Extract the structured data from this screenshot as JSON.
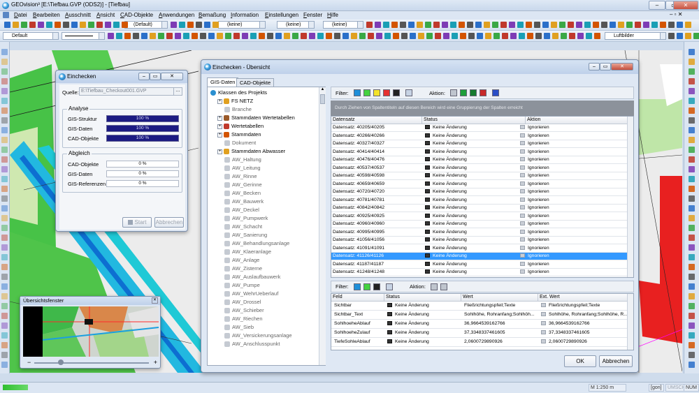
{
  "app": {
    "title": "GEOvision³  [E:\\Tiefbau.GVP (ODS2)] - [Tiefbau]",
    "menu": [
      "Datei",
      "Bearbeiten",
      "Ausschnitt",
      "Ansicht",
      "CAD-Objekte",
      "Anwendungen",
      "Bemaßung",
      "Information",
      "Einstellungen",
      "Fenster",
      "Hilfe"
    ]
  },
  "toolbar": {
    "combo_default_1": "(Default)",
    "combo_keine_1": "(keine)",
    "combo_keine_2": "(keine)",
    "combo_keine_3": "(keine)",
    "layer_default": "Default",
    "luftbilder": "Luftbilder"
  },
  "colors": {
    "accent": "#3399ff",
    "bar_fill": "#1c1b82",
    "canal": "#22b8e0",
    "building": "#e82020"
  },
  "einchecken": {
    "title": "Einchecken",
    "quelle_label": "Quelle:",
    "quelle_value": "E:\\Tiefbau_Checkout001.GVP",
    "analyse_label": "Analyse",
    "analyse": [
      {
        "label": "GIS-Struktur",
        "value": "100 %",
        "fraction": 1.0
      },
      {
        "label": "GIS-Daten",
        "value": "100 %",
        "fraction": 1.0
      },
      {
        "label": "CAD-Objekte",
        "value": "100 %",
        "fraction": 1.0
      }
    ],
    "abgleich_label": "Abgleich",
    "abgleich": [
      {
        "label": "CAD-Objekte",
        "value": "0 %",
        "fraction": 0.0
      },
      {
        "label": "GIS-Daten",
        "value": "0 %",
        "fraction": 0.0
      },
      {
        "label": "GIS-Referenzen",
        "value": "0 %",
        "fraction": 0.0
      }
    ],
    "start_label": "Start",
    "abbrechen_label": "Abbrechen"
  },
  "overview_window": {
    "title": "Übersichtsfenster"
  },
  "uebersicht": {
    "title": "Einchecken - Übersicht",
    "tabs": [
      "GIS-Daten",
      "CAD-Objekte"
    ],
    "tree": [
      {
        "label": "Klassen des Projekts",
        "level": 0,
        "bold": false
      },
      {
        "label": "FS NETZ",
        "level": 1,
        "bold": false
      },
      {
        "label": "Branche",
        "level": 2,
        "bold": false
      },
      {
        "label": "Stammdaten Wertetabellen",
        "level": 1,
        "bold": false
      },
      {
        "label": "Wertetabellen",
        "level": 1,
        "bold": false
      },
      {
        "label": "Stammdaten",
        "level": 1,
        "bold": false
      },
      {
        "label": "Dokument",
        "level": 2,
        "bold": false
      },
      {
        "label": "Stammdaten Abwasser",
        "level": 1,
        "bold": false
      },
      {
        "label": "AW_Haltung",
        "level": 2,
        "bold": false
      },
      {
        "label": "AW_Leitung",
        "level": 2,
        "bold": false
      },
      {
        "label": "AW_Rinne",
        "level": 2,
        "bold": false
      },
      {
        "label": "AW_Gerinne",
        "level": 2,
        "bold": false
      },
      {
        "label": "AW_Becken",
        "level": 2,
        "bold": false
      },
      {
        "label": "AW_Bauwerk",
        "level": 2,
        "bold": false
      },
      {
        "label": "AW_Deckel",
        "level": 2,
        "bold": false
      },
      {
        "label": "AW_Pumpwerk",
        "level": 2,
        "bold": false
      },
      {
        "label": "AW_Schacht",
        "level": 2,
        "bold": false
      },
      {
        "label": "AW_Sanierung",
        "level": 2,
        "bold": false
      },
      {
        "label": "AW_Behandlungsanlage",
        "level": 2,
        "bold": false
      },
      {
        "label": "AW_Klaeranlage",
        "level": 2,
        "bold": false
      },
      {
        "label": "AW_Anlage",
        "level": 2,
        "bold": false
      },
      {
        "label": "AW_Zisterne",
        "level": 2,
        "bold": false
      },
      {
        "label": "AW_Auslaufbauwerk",
        "level": 2,
        "bold": false
      },
      {
        "label": "AW_Pumpe",
        "level": 2,
        "bold": false
      },
      {
        "label": "AW_WehrUeberlauf",
        "level": 2,
        "bold": false
      },
      {
        "label": "AW_Drossel",
        "level": 2,
        "bold": false
      },
      {
        "label": "AW_Schieber",
        "level": 2,
        "bold": false
      },
      {
        "label": "AW_Riechen",
        "level": 2,
        "bold": false
      },
      {
        "label": "AW_Sieb",
        "level": 2,
        "bold": false
      },
      {
        "label": "AW_Versickerungsanlage",
        "level": 2,
        "bold": false
      },
      {
        "label": "AW_Anschlusspunkt",
        "level": 2,
        "bold": false
      }
    ],
    "filter_label": "Filter:",
    "aktion_label": "Aktion:",
    "group_hint": "Durch Ziehen von Spaltentiteln auf diesen Bereich wird eine Gruppierung der Spalten erreicht",
    "columns": [
      "Datensatz",
      "Status",
      "Aktion"
    ],
    "rows": [
      [
        "Datensatz: 40205/40205",
        "Keine Änderung",
        "Ignorieren"
      ],
      [
        "Datensatz: 40266/40266",
        "Keine Änderung",
        "Ignorieren"
      ],
      [
        "Datensatz: 40327/40327",
        "Keine Änderung",
        "Ignorieren"
      ],
      [
        "Datensatz: 40414/40414",
        "Keine Änderung",
        "Ignorieren"
      ],
      [
        "Datensatz: 40476/40476",
        "Keine Änderung",
        "Ignorieren"
      ],
      [
        "Datensatz: 40537/40537",
        "Keine Änderung",
        "Ignorieren"
      ],
      [
        "Datensatz: 40598/40598",
        "Keine Änderung",
        "Ignorieren"
      ],
      [
        "Datensatz: 40659/40659",
        "Keine Änderung",
        "Ignorieren"
      ],
      [
        "Datensatz: 40720/40720",
        "Keine Änderung",
        "Ignorieren"
      ],
      [
        "Datensatz: 40781/40781",
        "Keine Änderung",
        "Ignorieren"
      ],
      [
        "Datensatz: 40842/40842",
        "Keine Änderung",
        "Ignorieren"
      ],
      [
        "Datensatz: 40925/40925",
        "Keine Änderung",
        "Ignorieren"
      ],
      [
        "Datensatz: 40960/40960",
        "Keine Änderung",
        "Ignorieren"
      ],
      [
        "Datensatz: 40995/40995",
        "Keine Änderung",
        "Ignorieren"
      ],
      [
        "Datensatz: 41056/41056",
        "Keine Änderung",
        "Ignorieren"
      ],
      [
        "Datensatz: 41091/41091",
        "Keine Änderung",
        "Ignorieren"
      ],
      [
        "Datensatz: 41126/41126",
        "Keine Änderung",
        "Ignorieren"
      ],
      [
        "Datensatz: 41187/41187",
        "Keine Änderung",
        "Ignorieren"
      ],
      [
        "Datensatz: 41248/41248",
        "Keine Änderung",
        "Ignorieren"
      ]
    ],
    "selected_row": 16,
    "detail_columns": [
      "Feld",
      "Status",
      "Wert",
      "Ext. Wert"
    ],
    "detail_rows": [
      [
        "Sichtbar",
        "Keine Änderung",
        "Fließrichtungspfeil;Texte",
        "Fließrichtungspfeil;Texte"
      ],
      [
        "Sichtbar_Text",
        "Keine Änderung",
        "Sohlhöhe, Rohranfang;Sohlhöh...",
        "Sohlhöhe, Rohranfang;Sohlhöhe, R..."
      ],
      [
        "SohlhoeheAblauf",
        "Keine Änderung",
        "36,9664539162766",
        "36,9664539162766"
      ],
      [
        "SohlhoeheZulauf",
        "Keine Änderung",
        "37,3348337461605",
        "37,3348337461605"
      ],
      [
        "TiefeSohleAblauf",
        "Keine Änderung",
        "2,0600729890926",
        "2,0600729890926"
      ]
    ],
    "ok_label": "OK",
    "abbrechen_label": "Abbrechen"
  },
  "statusbar": {
    "scale": "M 1:250  m",
    "gon": "[gon]",
    "umsch": "UMSCH",
    "num": "NUM"
  }
}
